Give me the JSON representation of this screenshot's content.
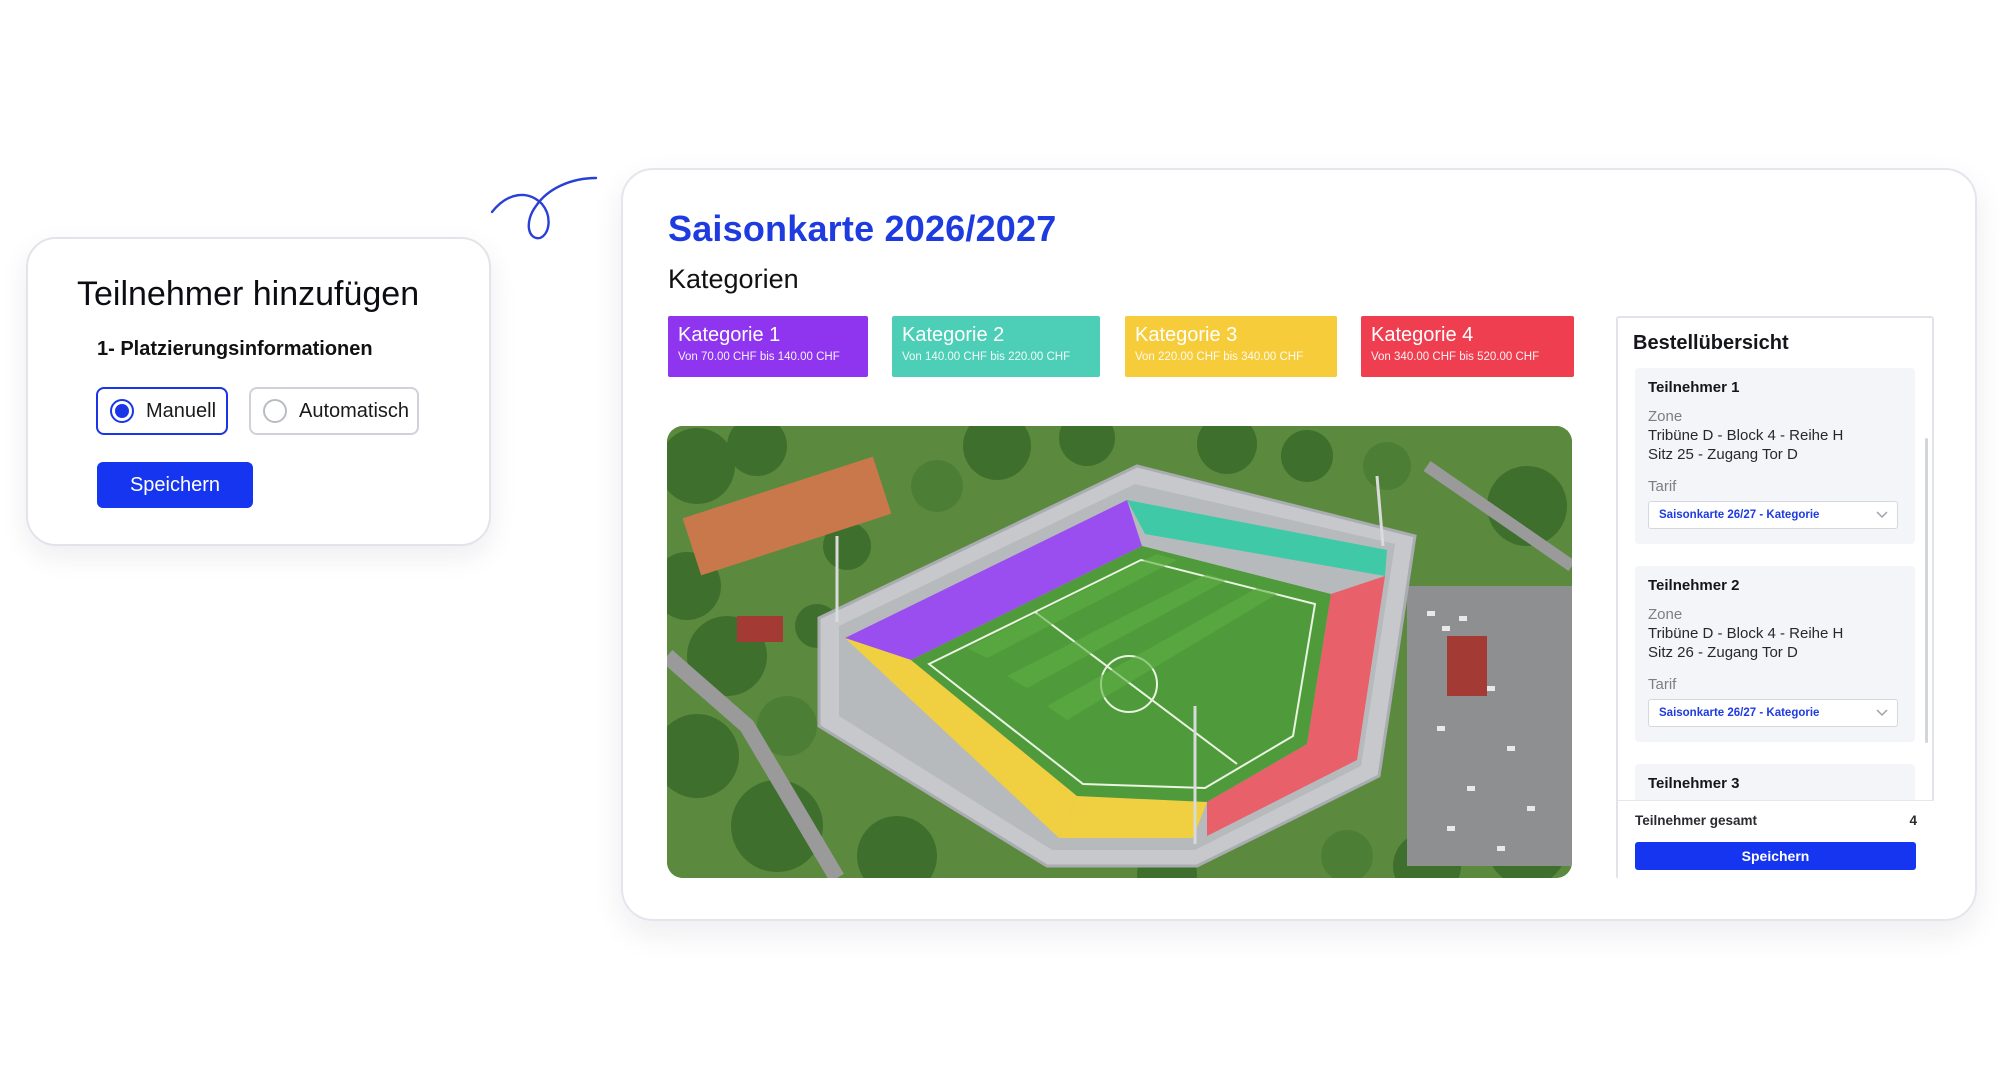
{
  "add_participant": {
    "title": "Teilnehmer hinzufügen",
    "subtitle": "1- Platzierungsinformationen",
    "options": [
      {
        "label": "Manuell",
        "selected": true
      },
      {
        "label": "Automatisch",
        "selected": false
      }
    ],
    "save_label": "Speichern"
  },
  "main": {
    "title": "Saisonkarte 2026/2027",
    "subtitle": "Kategorien",
    "categories": [
      {
        "name": "Kategorie 1",
        "range": "Von 70.00 CHF bis 140.00 CHF",
        "color": "#8f35ef"
      },
      {
        "name": "Kategorie 2",
        "range": "Von 140.00 CHF bis 220.00 CHF",
        "color": "#4ccfb6"
      },
      {
        "name": "Kategorie 3",
        "range": "Von 220.00 CHF bis 340.00 CHF",
        "color": "#f6cc3a"
      },
      {
        "name": "Kategorie 4",
        "range": "Von 340.00 CHF bis 520.00 CHF",
        "color": "#ef3e4f"
      }
    ]
  },
  "order": {
    "title": "Bestellübersicht",
    "zone_label": "Zone",
    "tarif_label": "Tarif",
    "participants": [
      {
        "name": "Teilnehmer 1",
        "zone_line1": "Tribüne D - Block 4 - Reihe H",
        "zone_line2": "Sitz 25 - Zugang Tor D",
        "tarif": "Saisonkarte 26/27 - Kategorie"
      },
      {
        "name": "Teilnehmer 2",
        "zone_line1": "Tribüne D - Block 4 - Reihe H",
        "zone_line2": "Sitz 26 - Zugang Tor D",
        "tarif": "Saisonkarte 26/27 - Kategorie"
      },
      {
        "name": "Teilnehmer 3"
      }
    ],
    "total_label": "Teilnehmer gesamt",
    "total_value": "4",
    "save_label": "Speichern"
  },
  "colors": {
    "accent": "#1535f0",
    "title_blue": "#1e3be0"
  }
}
